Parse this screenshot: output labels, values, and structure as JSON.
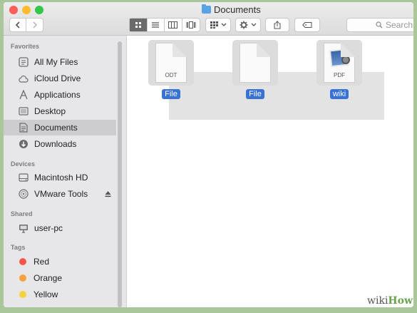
{
  "window": {
    "title": "Documents",
    "colors": {
      "close": "#fc5f57",
      "minimize": "#fdbc2e",
      "zoom": "#33c748"
    }
  },
  "toolbar": {
    "back_icon": "chevron-left-icon",
    "forward_icon": "chevron-right-icon",
    "views": [
      "icon-view",
      "list-view",
      "column-view",
      "cover-flow-view"
    ],
    "active_view": "icon-view",
    "arrange_icon": "grid-icon",
    "action_icon": "gear-icon",
    "share_icon": "share-icon",
    "tag_icon": "tag-icon",
    "search_placeholder": "Search"
  },
  "sidebar": {
    "favorites_heading": "Favorites",
    "favorites": [
      {
        "label": "All My Files",
        "icon": "all-files-icon"
      },
      {
        "label": "iCloud Drive",
        "icon": "cloud-icon"
      },
      {
        "label": "Applications",
        "icon": "applications-icon"
      },
      {
        "label": "Desktop",
        "icon": "desktop-icon"
      },
      {
        "label": "Documents",
        "icon": "documents-icon",
        "selected": true
      },
      {
        "label": "Downloads",
        "icon": "downloads-icon"
      }
    ],
    "devices_heading": "Devices",
    "devices": [
      {
        "label": "Macintosh HD",
        "icon": "hard-drive-icon"
      },
      {
        "label": "VMware Tools",
        "icon": "disc-icon",
        "eject": "eject-icon"
      }
    ],
    "shared_heading": "Shared",
    "shared": [
      {
        "label": "user-pc",
        "icon": "monitor-icon"
      }
    ],
    "tags_heading": "Tags",
    "tags": [
      {
        "label": "Red",
        "color": "#f5574f"
      },
      {
        "label": "Orange",
        "color": "#f7a23a"
      },
      {
        "label": "Yellow",
        "color": "#f6d33c"
      },
      {
        "label": "",
        "color": "#5cc751"
      }
    ]
  },
  "files": [
    {
      "name": "File",
      "ext": "ODT",
      "icon": "document-icon"
    },
    {
      "name": "File",
      "ext": "",
      "icon": "blank-document-icon"
    },
    {
      "name": "wiki",
      "ext": "PDF",
      "icon": "pdf-preview-icon"
    }
  ],
  "watermark": {
    "prefix": "wiki",
    "suffix": "How"
  }
}
